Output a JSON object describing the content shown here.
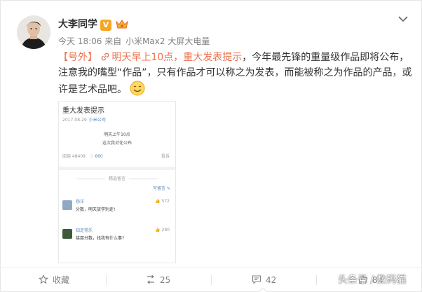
{
  "post": {
    "author": "大李同学",
    "timestamp": "今天 18:06",
    "source_prefix": "来自",
    "source": "小米Max2 大屏大电量",
    "tag": "【号外】",
    "link_text": "明天早上10点，重大发表提示",
    "text_part1": "，今年最先锋的重量级作品即将公布，注意我的嘴型“作品”，只有作品才可以称之为发表，而能被称之为作品的产品，或许是艺术品吧。"
  },
  "embed": {
    "title": "重大发表提示",
    "date": "2017-08-29",
    "company": "小米公司",
    "line1": "明天上午10点",
    "line2": "这次我对化公布",
    "reads": "阅读 48409",
    "likes": "660",
    "report": "投诉",
    "section_title": "精选留言",
    "write_comment": "写留言",
    "comments": [
      {
        "name": "杨洋",
        "text": "分数，明天放学别走!",
        "likes": "572"
      },
      {
        "name": "知足常乐",
        "text": "接惡分数，找我有什么事?",
        "likes": "280"
      }
    ]
  },
  "actions": {
    "favorite": "收藏",
    "repost_count": "25",
    "comment_count": "42",
    "like_count": "84"
  },
  "watermark": "头条号 / 数码猫",
  "colors": {
    "accent": "#eb7350",
    "link_blue": "#5a86bb",
    "muted": "#808080"
  }
}
